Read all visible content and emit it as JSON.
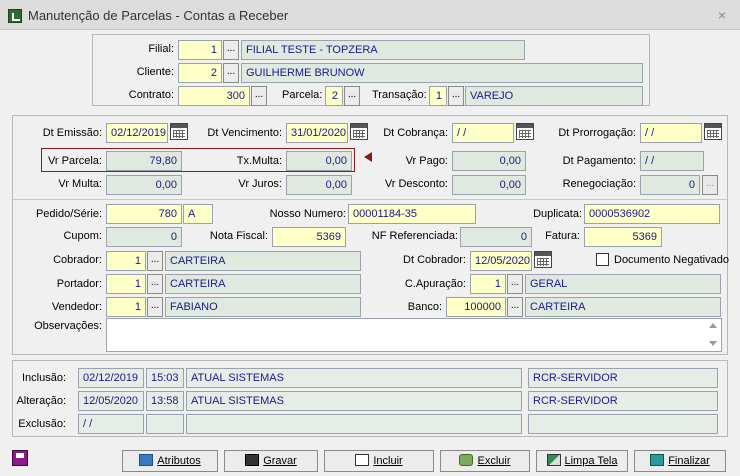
{
  "window": {
    "title": "Manutenção de Parcelas - Contas a Receber",
    "close": "×"
  },
  "header": {
    "filial_label": "Filial:",
    "filial_code": "1",
    "filial_name": "FILIAL TESTE - TOPZERA",
    "cliente_label": "Cliente:",
    "cliente_code": "2",
    "cliente_name": "GUILHERME BRUNOW",
    "contrato_label": "Contrato:",
    "contrato_value": "300",
    "parcela_label": "Parcela:",
    "parcela_value": "2",
    "transacao_label": "Transação:",
    "transacao_code": "1",
    "transacao_name": "VAREJO"
  },
  "dates": {
    "emissao_label": "Dt Emissão:",
    "emissao_value": "02/12/2019",
    "vencimento_label": "Dt Vencimento:",
    "vencimento_value": "31/01/2020",
    "cobranca_label": "Dt Cobrança:",
    "cobranca_value": "/ /",
    "prorrogacao_label": "Dt Prorrogação:",
    "prorrogacao_value": "/ /"
  },
  "values": {
    "vr_parcela_label": "Vr Parcela:",
    "vr_parcela": "79,80",
    "tx_multa_label": "Tx.Multa:",
    "tx_multa": "0,00",
    "vr_pago_label": "Vr Pago:",
    "vr_pago": "0,00",
    "dt_pagamento_label": "Dt Pagamento:",
    "dt_pagamento": "/ /",
    "vr_multa_label": "Vr Multa:",
    "vr_multa": "0,00",
    "vr_juros_label": "Vr Juros:",
    "vr_juros": "0,00",
    "vr_desconto_label": "Vr Desconto:",
    "vr_desconto": "0,00",
    "renegociacao_label": "Renegociação:",
    "renegociacao": "0"
  },
  "details": {
    "pedido_label": "Pedido/Série:",
    "pedido": "780",
    "serie": "A",
    "nosso_numero_label": "Nosso Numero:",
    "nosso_numero": "00001184-35",
    "duplicata_label": "Duplicata:",
    "duplicata": "0000536902",
    "cupom_label": "Cupom:",
    "cupom": "0",
    "nota_fiscal_label": "Nota Fiscal:",
    "nota_fiscal": "5369",
    "nf_ref_label": "NF Referenciada:",
    "nf_ref": "0",
    "fatura_label": "Fatura:",
    "fatura": "5369",
    "cobrador_label": "Cobrador:",
    "cobrador_code": "1",
    "cobrador_name": "CARTEIRA",
    "dt_cobrador_label": "Dt Cobrador:",
    "dt_cobrador": "12/05/2020",
    "doc_negativado_label": "Documento Negativado",
    "portador_label": "Portador:",
    "portador_code": "1",
    "portador_name": "CARTEIRA",
    "apuracao_label": "C.Apuração:",
    "apuracao_code": "1",
    "apuracao_name": "GERAL",
    "vendedor_label": "Vendedor:",
    "vendedor_code": "1",
    "vendedor_name": "FABIANO",
    "banco_label": "Banco:",
    "banco_code": "100000",
    "banco_name": "CARTEIRA",
    "observacoes_label": "Observações:"
  },
  "audit": {
    "inclusao_label": "Inclusão:",
    "inclusao_date": "02/12/2019",
    "inclusao_time": "15:03",
    "inclusao_user": "ATUAL SISTEMAS",
    "inclusao_host": "RCR-SERVIDOR",
    "alteracao_label": "Alteração:",
    "alteracao_date": "12/05/2020",
    "alteracao_time": "13:58",
    "alteracao_user": "ATUAL SISTEMAS",
    "alteracao_host": "RCR-SERVIDOR",
    "exclusao_label": "Exclusão:",
    "exclusao_date": "/ /"
  },
  "buttons": {
    "lookup": "...",
    "atributos": "Atributos",
    "gravar": "Gravar",
    "incluir": "Incluir",
    "excluir": "Excluir",
    "limpa_tela": "Limpa Tela",
    "finalizar": "Finalizar"
  }
}
